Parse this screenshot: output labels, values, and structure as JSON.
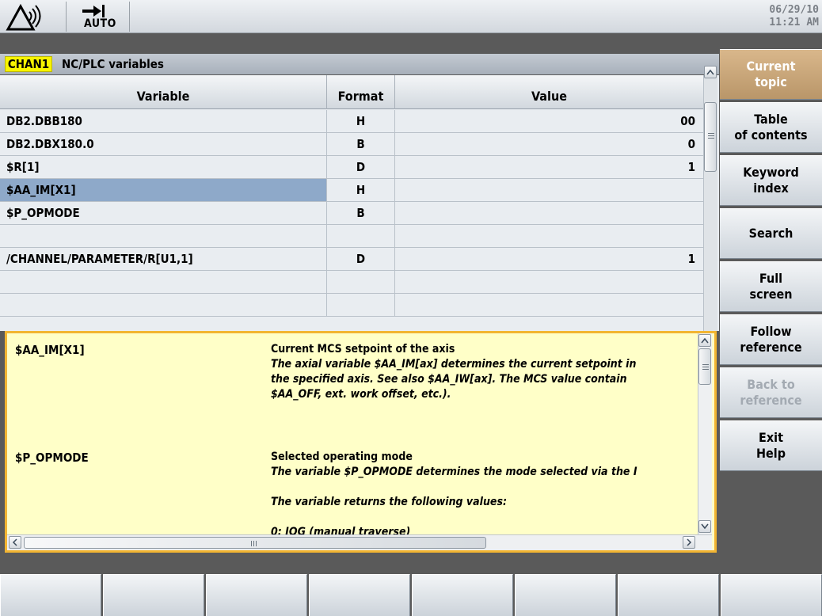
{
  "header": {
    "mode_label": "AUTO",
    "date": "06/29/10",
    "time": "11:21 AM"
  },
  "title_bar": {
    "channel": "CHAN1",
    "title": "NC/PLC variables"
  },
  "table": {
    "columns": {
      "variable": "Variable",
      "format": "Format",
      "value": "Value"
    },
    "rows": [
      {
        "variable": "DB2.DBB180",
        "format": "H",
        "value": "00"
      },
      {
        "variable": "DB2.DBX180.0",
        "format": "B",
        "value": "0"
      },
      {
        "variable": "$R[1]",
        "format": "D",
        "value": "1"
      },
      {
        "variable": "$AA_IM[X1]",
        "format": "H",
        "value": ""
      },
      {
        "variable": "$P_OPMODE",
        "format": "B",
        "value": ""
      },
      {
        "variable": "",
        "format": "",
        "value": ""
      },
      {
        "variable": "/CHANNEL/PARAMETER/R[U1,1]",
        "format": "D",
        "value": "1"
      },
      {
        "variable": "",
        "format": "",
        "value": ""
      },
      {
        "variable": "",
        "format": "",
        "value": ""
      }
    ],
    "selected_row_index": 3
  },
  "help": {
    "entries": [
      {
        "name": "$AA_IM[X1]",
        "title": "Current MCS setpoint of the axis",
        "desc_lines": [
          "The axial variable $AA_IM[ax] determines the current setpoint in",
          "the specified axis. See also $AA_IW[ax]. The MCS value contain",
          "$AA_OFF, ext. work offset, etc.)."
        ]
      },
      {
        "name": "$P_OPMODE",
        "title": "Selected operating mode",
        "desc_lines": [
          "The variable $P_OPMODE determines the mode selected via the I",
          "",
          "The variable returns the following values:",
          "",
          "0: JOG (manual traverse)"
        ]
      }
    ]
  },
  "right_softkeys": [
    {
      "label": [
        "Current",
        "topic"
      ],
      "state": "active"
    },
    {
      "label": [
        "Table",
        "of contents"
      ],
      "state": "normal"
    },
    {
      "label": [
        "Keyword",
        "index"
      ],
      "state": "normal"
    },
    {
      "label": [
        "Search"
      ],
      "state": "normal"
    },
    {
      "label": [
        "Full",
        "screen"
      ],
      "state": "normal"
    },
    {
      "label": [
        "Follow",
        "reference"
      ],
      "state": "normal"
    },
    {
      "label": [
        "Back to",
        "reference"
      ],
      "state": "disabled"
    },
    {
      "label": [
        "Exit",
        "Help"
      ],
      "state": "normal"
    }
  ],
  "bottom_softkeys": [
    "",
    "",
    "",
    "",
    "",
    "",
    "",
    ""
  ],
  "icons": {
    "alarm": "alarm-signal-icon",
    "mode": "mode-arrow-icon"
  },
  "colors": {
    "channel_badge": "#f8f400",
    "selected_row": "#8ea9c9",
    "help_background": "#ffffc8",
    "help_border": "#f2b532",
    "active_softkey": "#c9a67a"
  }
}
